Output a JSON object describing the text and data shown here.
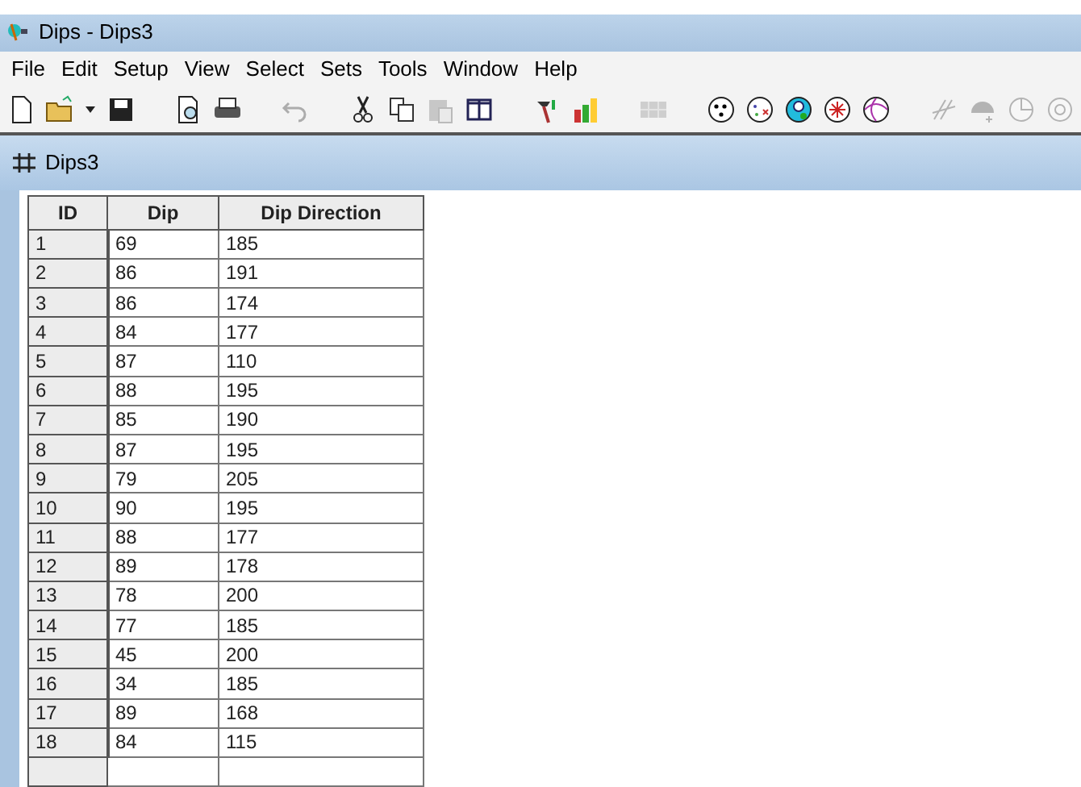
{
  "window": {
    "title": "Dips - Dips3"
  },
  "menu": [
    "File",
    "Edit",
    "Setup",
    "View",
    "Select",
    "Sets",
    "Tools",
    "Window",
    "Help"
  ],
  "child_window": {
    "title": "Dips3"
  },
  "table": {
    "columns": [
      "ID",
      "Dip",
      "Dip Direction"
    ],
    "rows": [
      [
        "1",
        "69",
        "185"
      ],
      [
        "2",
        "86",
        "191"
      ],
      [
        "3",
        "86",
        "174"
      ],
      [
        "4",
        "84",
        "177"
      ],
      [
        "5",
        "87",
        "110"
      ],
      [
        "6",
        "88",
        "195"
      ],
      [
        "7",
        "85",
        "190"
      ],
      [
        "8",
        "87",
        "195"
      ],
      [
        "9",
        "79",
        "205"
      ],
      [
        "10",
        "90",
        "195"
      ],
      [
        "11",
        "88",
        "177"
      ],
      [
        "12",
        "89",
        "178"
      ],
      [
        "13",
        "78",
        "200"
      ],
      [
        "14",
        "77",
        "185"
      ],
      [
        "15",
        "45",
        "200"
      ],
      [
        "16",
        "34",
        "185"
      ],
      [
        "17",
        "89",
        "168"
      ],
      [
        "18",
        "84",
        "115"
      ]
    ]
  }
}
